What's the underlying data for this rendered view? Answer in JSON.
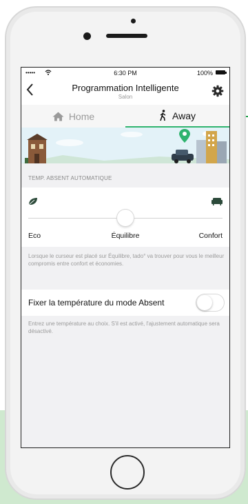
{
  "status_bar": {
    "signal": "•••••",
    "time": "6:30 PM",
    "battery": "100%"
  },
  "nav": {
    "title": "Programmation Intelligente",
    "subtitle": "Salon"
  },
  "tabs": [
    {
      "label": "Home",
      "active": false
    },
    {
      "label": "Away",
      "active": true
    }
  ],
  "section": {
    "header": "TEMP. ABSENT AUTOMATIQUE"
  },
  "slider": {
    "labels": {
      "left": "Eco",
      "center": "Équilibre",
      "right": "Confort"
    },
    "value": 0.5
  },
  "slider_description": "Lorsque le curseur est placé sur Équilibre, tado° va trouver pour vous le meilleur compromis entre confort et économies.",
  "fixed_temp": {
    "label": "Fixer la température du mode Absent",
    "enabled": false,
    "description": "Entrez une température au choix. S'il est activé, l'ajustement automatique sera désactivé."
  },
  "colors": {
    "accent": "#2fb36e",
    "marker": "#1fa24a"
  }
}
